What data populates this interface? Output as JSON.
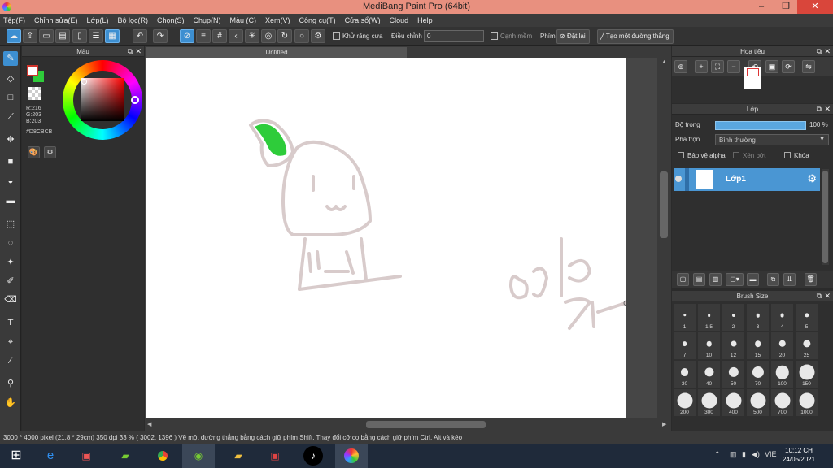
{
  "window": {
    "title": "MediBang Paint Pro (64bit)",
    "minimize_glyph": "–",
    "maximize_glyph": "❐",
    "close_glyph": "✕"
  },
  "menu": [
    "Tệp(F)",
    "Chỉnh sửa(E)",
    "Lớp(L)",
    "Bộ lọc(R)",
    "Chọn(S)",
    "Chụp(N)",
    "Màu (C)",
    "Xem(V)",
    "Công cụ(T)",
    "Cửa sổ(W)",
    "Cloud",
    "Help"
  ],
  "toolbar": {
    "antialias_label": "Khử răng cưa",
    "correction_label": "Điều chỉnh",
    "correction_value": "0",
    "soft_edge_label": "Cạnh mềm",
    "shortcut_label": "Phím",
    "reset_label": "Đặt lại",
    "straight_line_label": "Tạo một đường thẳng"
  },
  "color_panel": {
    "title": "Màu",
    "r": "R:216",
    "g": "G:203",
    "b": "B:203",
    "hex": "#D8CBCB",
    "fg_color": "#ffffff",
    "bg_color": "#2ecc3a"
  },
  "document": {
    "tab_title": "Untitled"
  },
  "navigator": {
    "title": "Hoa tiêu"
  },
  "layer_panel": {
    "title": "Lớp",
    "opacity_label": "Độ trong",
    "opacity_value": "100 %",
    "opacity_fraction": 1.0,
    "blend_label": "Pha trộn",
    "blend_value": "Bình thường",
    "protect_alpha_label": "Bảo vệ alpha",
    "clipping_label": "Xén bớt",
    "lock_label": "Khóa",
    "layers": [
      {
        "name": "Lớp1",
        "visible": true
      }
    ]
  },
  "brush_size": {
    "title": "Brush Size",
    "sizes": [
      "1",
      "1.5",
      "2",
      "3",
      "4",
      "5",
      "7",
      "10",
      "12",
      "15",
      "20",
      "25",
      "30",
      "40",
      "50",
      "70",
      "100",
      "150",
      "200",
      "300",
      "400",
      "500",
      "700",
      "1000"
    ]
  },
  "status": {
    "text": "3000 * 4000 pixel   (21.8 * 29cm)   350 dpi   33 %   ( 3002, 1396 )   Vẽ một đường thẳng bằng cách giữ phím Shift, Thay đổi cỡ cọ bằng cách giữ phím Ctrl, Alt và kéo"
  },
  "taskbar": {
    "language": "VIE",
    "time": "10:12 CH",
    "date": "24/05/2021"
  }
}
